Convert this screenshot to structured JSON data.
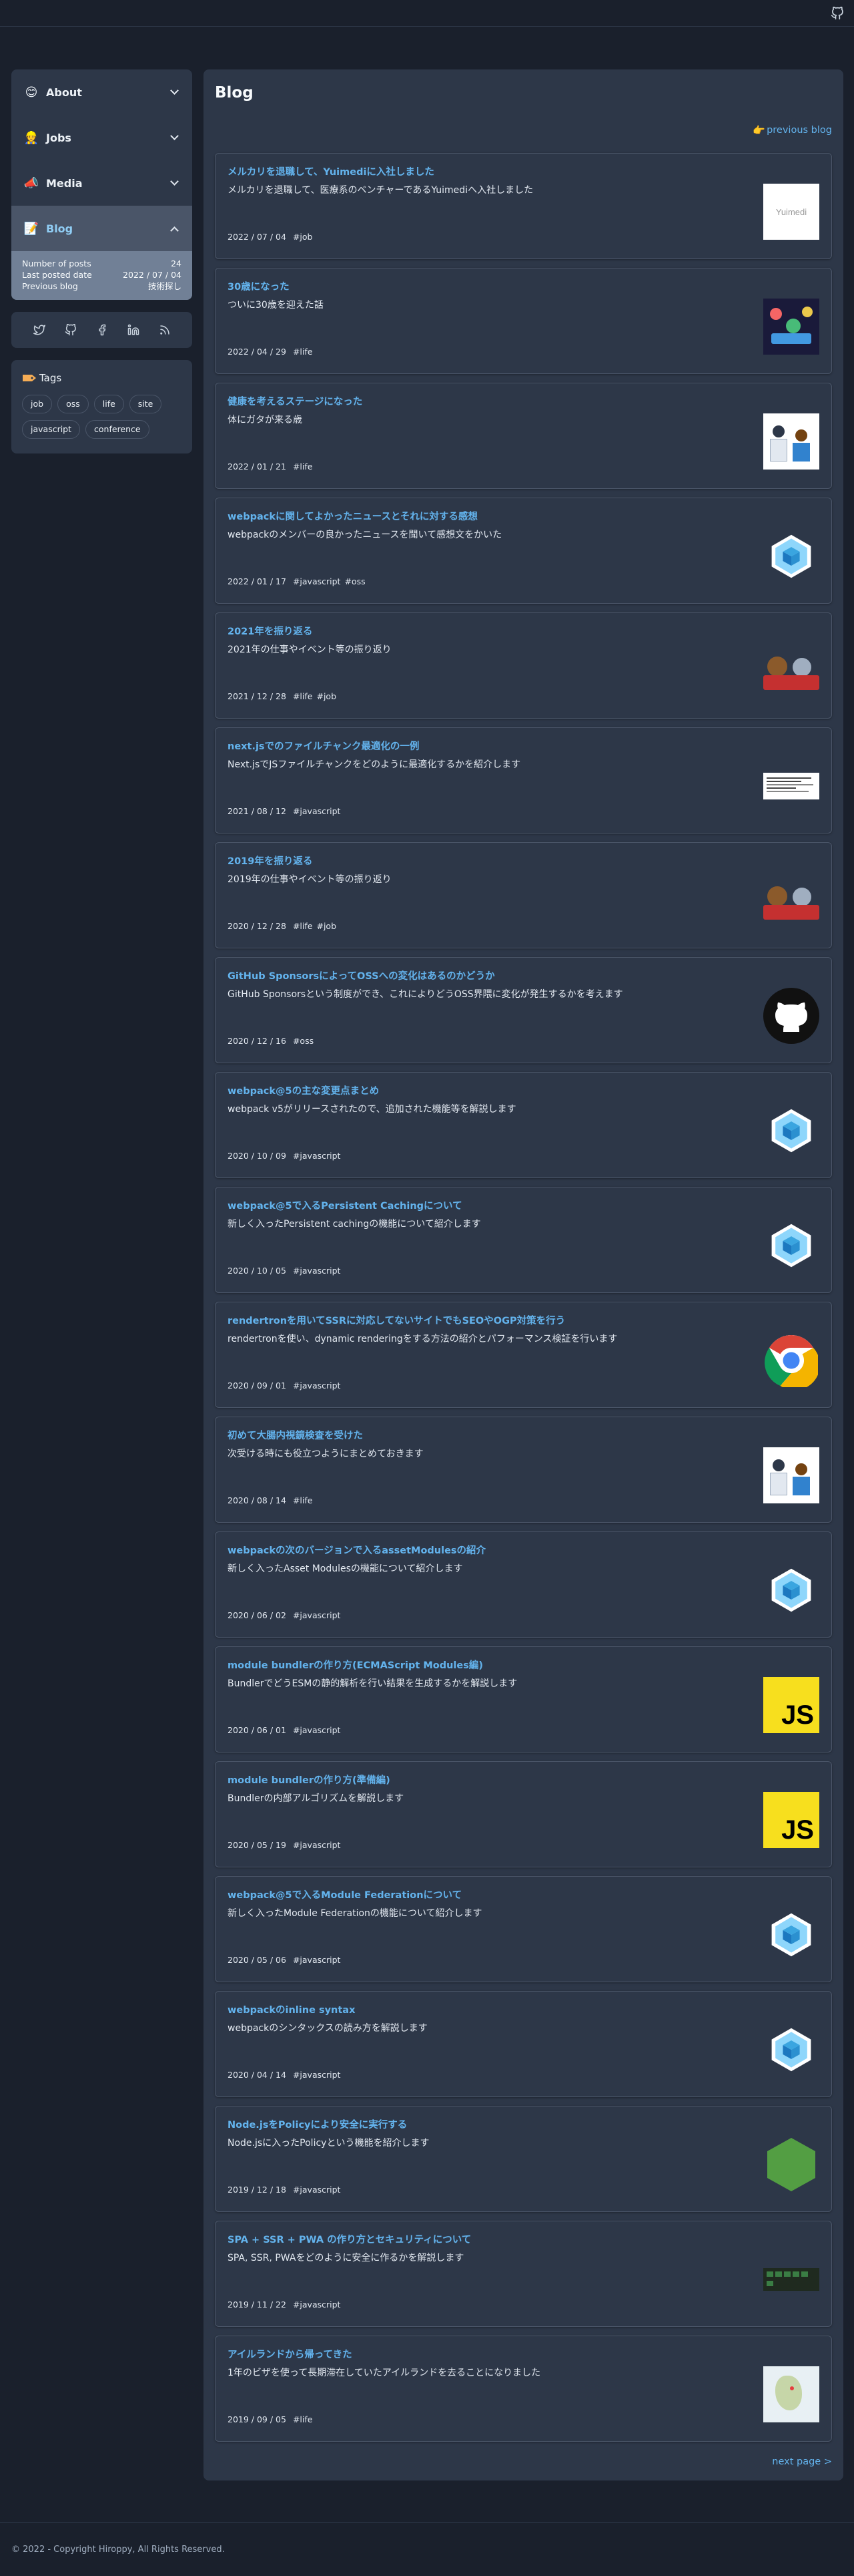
{
  "sidebar": {
    "menu": [
      {
        "label": "About",
        "emoji": "😊",
        "open": false
      },
      {
        "label": "Jobs",
        "emoji": "👷",
        "open": false
      },
      {
        "label": "Media",
        "emoji": "📣",
        "open": false
      },
      {
        "label": "Blog",
        "emoji": "📝",
        "open": true
      }
    ],
    "blog_details": [
      {
        "label": "Number of posts",
        "value": "24"
      },
      {
        "label": "Last posted date",
        "value": "2022 / 07 / 04"
      },
      {
        "label": "Previous blog",
        "value": "技術探し"
      }
    ],
    "social_icons": [
      "twitter-icon",
      "github-icon",
      "facebook-icon",
      "linkedin-icon",
      "rss-icon"
    ],
    "tags_title": "Tags",
    "tags": [
      "job",
      "oss",
      "life",
      "site",
      "javascript",
      "conference"
    ]
  },
  "main": {
    "title": "Blog",
    "previous_blog": "previous blog",
    "next_blog": "next page >",
    "posts": [
      {
        "title": "メルカリを退職して、Yuimediに入社しました",
        "desc": "メルカリを退職して、医療系のベンチャーであるYuimediへ入社しました",
        "date": "2022 / 07 / 04",
        "tags": [
          "#job"
        ],
        "thumb": "yuimedi-logo"
      },
      {
        "title": "30歳になった",
        "desc": "ついに30歳を迎えた話",
        "date": "2022 / 04 / 29",
        "tags": [
          "#life"
        ],
        "thumb": "party-illustration"
      },
      {
        "title": "健康を考えるステージになった",
        "desc": "体にガタが来る歳",
        "date": "2022 / 01 / 21",
        "tags": [
          "#life"
        ],
        "thumb": "doctor-illustration"
      },
      {
        "title": "webpackに関してよかったニュースとそれに対する感想",
        "desc": "webpackのメンバーの良かったニュースを聞いて感想文をかいた",
        "date": "2022 / 01 / 17",
        "tags": [
          "#javascript",
          "#oss"
        ],
        "thumb": "webpack-logo"
      },
      {
        "title": "2021年を振り返る",
        "desc": "2021年の仕事やイベント等の振り返り",
        "date": "2021 / 12 / 28",
        "tags": [
          "#life",
          "#job"
        ],
        "thumb": "animals-illustration"
      },
      {
        "title": "next.jsでのファイルチャンク最適化の一例",
        "desc": "Next.jsでJSファイルチャンクをどのように最適化するかを紹介します",
        "date": "2021 / 08 / 12",
        "tags": [
          "#javascript"
        ],
        "thumb": "code-screenshot"
      },
      {
        "title": "2019年を振り返る",
        "desc": "2019年の仕事やイベント等の振り返り",
        "date": "2020 / 12 / 28",
        "tags": [
          "#life",
          "#job"
        ],
        "thumb": "animals-illustration"
      },
      {
        "title": "GitHub SponsorsによってOSSへの変化はあるのかどうか",
        "desc": "GitHub Sponsorsという制度ができ、これによりどうOSS界隈に変化が発生するかを考えます",
        "date": "2020 / 12 / 16",
        "tags": [
          "#oss"
        ],
        "thumb": "github-logo"
      },
      {
        "title": "webpack@5の主な変更点まとめ",
        "desc": "webpack v5がリリースされたので、追加された機能等を解説します",
        "date": "2020 / 10 / 09",
        "tags": [
          "#javascript"
        ],
        "thumb": "webpack-logo"
      },
      {
        "title": "webpack@5で入るPersistent Cachingについて",
        "desc": "新しく入ったPersistent cachingの機能について紹介します",
        "date": "2020 / 10 / 05",
        "tags": [
          "#javascript"
        ],
        "thumb": "webpack-logo"
      },
      {
        "title": "rendertronを用いてSSRに対応してないサイトでもSEOやOGP対策を行う",
        "desc": "rendertronを使い、dynamic renderingをする方法の紹介とパフォーマンス検証を行います",
        "date": "2020 / 09 / 01",
        "tags": [
          "#javascript"
        ],
        "thumb": "chrome-logo"
      },
      {
        "title": "初めて大腸内視鏡検査を受けた",
        "desc": "次受ける時にも役立つようにまとめておきます",
        "date": "2020 / 08 / 14",
        "tags": [
          "#life"
        ],
        "thumb": "hospital-illustration"
      },
      {
        "title": "webpackの次のバージョンで入るassetModulesの紹介",
        "desc": "新しく入ったAsset Modulesの機能について紹介します",
        "date": "2020 / 06 / 02",
        "tags": [
          "#javascript"
        ],
        "thumb": "webpack-logo"
      },
      {
        "title": "module bundlerの作り方(ECMAScript Modules編)",
        "desc": "BundlerでどうESMの静的解析を行い結果を生成するかを解説します",
        "date": "2020 / 06 / 01",
        "tags": [
          "#javascript"
        ],
        "thumb": "js-logo"
      },
      {
        "title": "module bundlerの作り方(準備編)",
        "desc": "Bundlerの内部アルゴリズムを解説します",
        "date": "2020 / 05 / 19",
        "tags": [
          "#javascript"
        ],
        "thumb": "js-logo"
      },
      {
        "title": "webpack@5で入るModule Federationについて",
        "desc": "新しく入ったModule Federationの機能について紹介します",
        "date": "2020 / 05 / 06",
        "tags": [
          "#javascript"
        ],
        "thumb": "webpack-logo"
      },
      {
        "title": "webpackのinline syntax",
        "desc": "webpackのシンタックスの読み方を解説します",
        "date": "2020 / 04 / 14",
        "tags": [
          "#javascript"
        ],
        "thumb": "webpack-logo"
      },
      {
        "title": "Node.jsをPolicyにより安全に実行する",
        "desc": "Node.jsに入ったPolicyという機能を紹介します",
        "date": "2019 / 12 / 18",
        "tags": [
          "#javascript"
        ],
        "thumb": "nodejs-logo"
      },
      {
        "title": "SPA + SSR + PWA の作り方とセキュリティについて",
        "desc": "SPA, SSR, PWAをどのように安全に作るかを解説します",
        "date": "2019 / 11 / 22",
        "tags": [
          "#javascript"
        ],
        "thumb": "slides-thumbnail"
      },
      {
        "title": "アイルランドから帰ってきた",
        "desc": "1年のビザを使って長期滞在していたアイルランドを去ることになりました",
        "date": "2019 / 09 / 05",
        "tags": [
          "#life"
        ],
        "thumb": "map-thumbnail"
      }
    ]
  },
  "thumb_text": {
    "yuimedi": "Yuimedi",
    "js": "JS"
  },
  "footer": "© 2022 - Copyright Hiroppy, All Rights Reserved."
}
